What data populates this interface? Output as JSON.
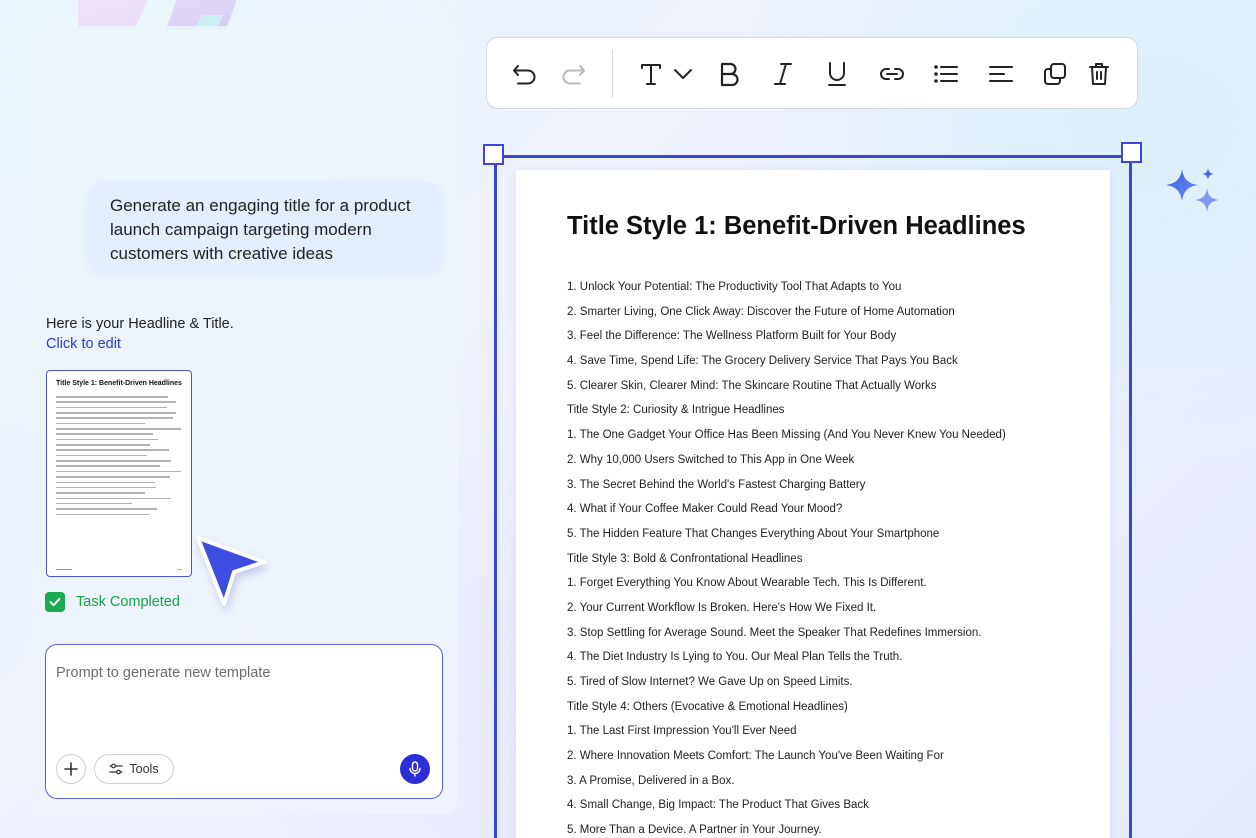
{
  "chat": {
    "prompt": "Generate an engaging title for a product launch campaign targeting modern customers with creative ideas",
    "reply": "Here is your Headline & Title.",
    "edit_link": "Click to edit",
    "thumbnail_title": "Title Style 1: Benefit-Driven Headlines",
    "task_status": "Task Completed"
  },
  "composer": {
    "placeholder": "Prompt to generate new template",
    "tools_label": "Tools"
  },
  "toolbar": {
    "buttons": [
      "undo-icon",
      "redo-icon",
      "text-style-icon",
      "chevron-down-icon",
      "bold-icon",
      "italic-icon",
      "underline-icon",
      "link-icon",
      "bullet-list-icon",
      "align-left-icon",
      "duplicate-icon",
      "delete-icon"
    ]
  },
  "document": {
    "title": "Title Style 1: Benefit-Driven Headlines",
    "lines": [
      "1. Unlock Your Potential: The Productivity Tool That Adapts to You",
      "2. Smarter Living, One Click Away: Discover the Future of Home Automation",
      "3. Feel the Difference: The Wellness Platform Built for Your Body",
      "4. Save Time, Spend Life: The Grocery Delivery Service That Pays You Back",
      "5. Clearer Skin, Clearer Mind: The Skincare Routine That Actually Works",
      "Title Style 2: Curiosity & Intrigue Headlines",
      "1. The One Gadget Your Office Has Been Missing (And You Never Knew You Needed)",
      "2. Why 10,000 Users Switched to This App in One Week",
      "3. The Secret Behind the World's Fastest Charging Battery",
      "4. What if Your Coffee Maker Could Read Your Mood?",
      "5. The Hidden Feature That Changes Everything About Your Smartphone",
      "Title Style 3: Bold & Confrontational Headlines",
      "1. Forget Everything You Know About Wearable Tech. This Is Different.",
      "2. Your Current Workflow Is Broken. Here's How We Fixed It.",
      "3. Stop Settling for Average Sound. Meet the Speaker That Redefines Immersion.",
      "4. The Diet Industry Is Lying to You. Our Meal Plan Tells the Truth.",
      "5. Tired of Slow Internet? We Gave Up on Speed Limits.",
      "Title Style 4: Others (Evocative & Emotional Headlines)",
      "1. The Last First Impression You'll Ever Need",
      "2. Where Innovation Meets Comfort: The Launch You've Been Waiting For",
      "3. A Promise, Delivered in a Box.",
      "4. Small Change, Big Impact: The Product That Gives Back",
      "5. More Than a Device. A Partner in Your Journey."
    ]
  },
  "colors": {
    "accent": "#3b47dc",
    "link": "#2a3bd6",
    "success": "#1aaa52",
    "mic": "#2c2fd6"
  }
}
